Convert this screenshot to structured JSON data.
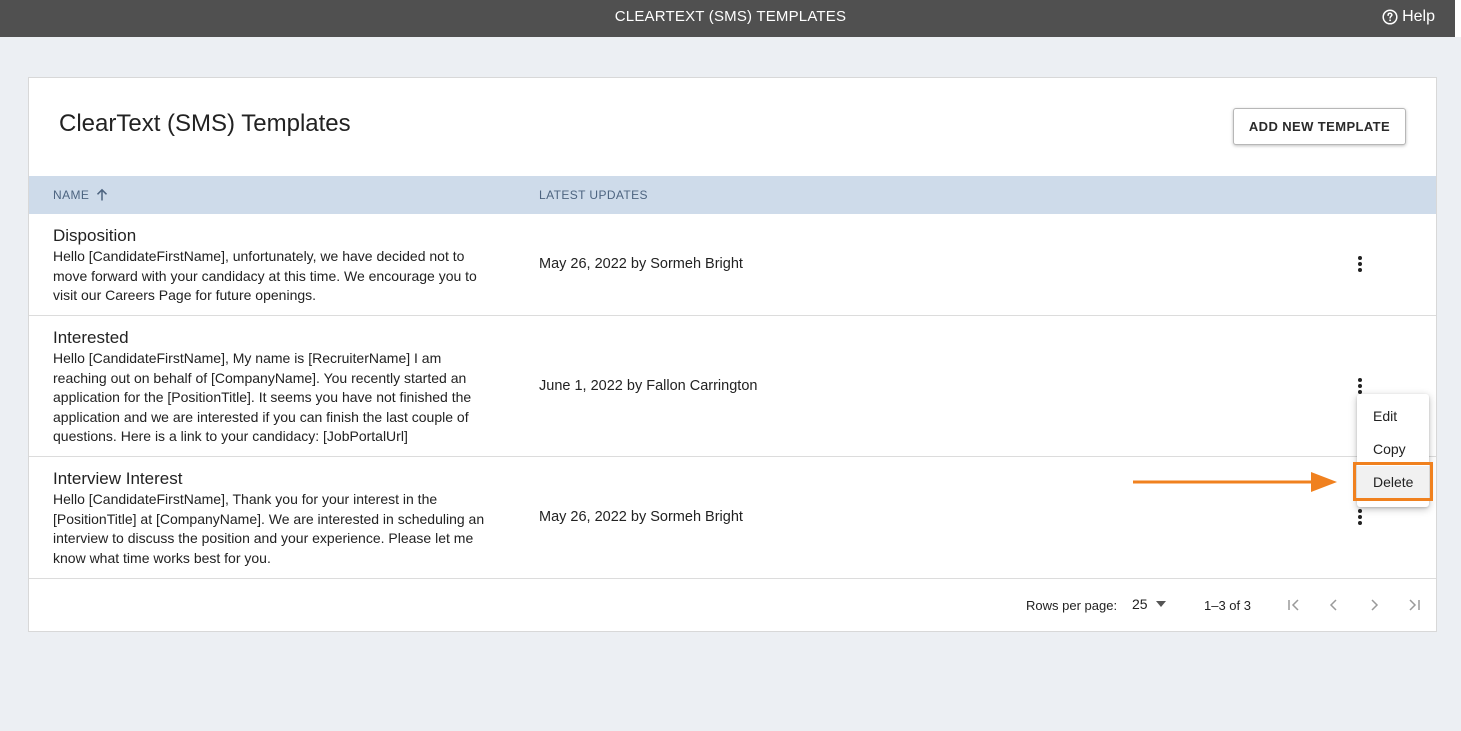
{
  "app": {
    "header_title": "CLEARTEXT (SMS) TEMPLATES",
    "help_label": "Help"
  },
  "card": {
    "title": "ClearText (SMS) Templates",
    "add_button": "ADD NEW TEMPLATE"
  },
  "table": {
    "columns": [
      {
        "label": "NAME",
        "sort": "ascending"
      },
      {
        "label": "LATEST UPDATES"
      }
    ],
    "rows": [
      {
        "name": "Disposition",
        "body_lines": [
          "Hello [CandidateFirstName], unfortunately, we have decided not to",
          "move forward with your candidacy at this time. We encourage you to",
          "visit our Careers Page for future openings."
        ],
        "updated": "May 26, 2022 by Sormeh Bright"
      },
      {
        "name": "Interested",
        "body_lines": [
          "Hello [CandidateFirstName], My name is [RecruiterName] I am",
          "reaching out on behalf of [CompanyName]. You recently started an",
          "application for the [PositionTitle]. It seems you have not finished the",
          "application and we are interested if you can finish the last couple of",
          "questions. Here is a link to your candidacy: [JobPortalUrl]"
        ],
        "updated": "June 1, 2022 by Fallon Carrington"
      },
      {
        "name": "Interview Interest",
        "body_lines": [
          "Hello [CandidateFirstName], Thank you for your interest in the",
          "[PositionTitle] at [CompanyName]. We are interested in scheduling an",
          "interview to discuss the position and your experience. Please let me",
          "know what time works best for you."
        ],
        "updated": "May 26, 2022 by Sormeh Bright"
      }
    ]
  },
  "context_menu": {
    "items": [
      "Edit",
      "Copy",
      "Delete"
    ],
    "highlighted": "Delete"
  },
  "pagination": {
    "rows_per_page_label": "Rows per page:",
    "rows_per_page_value": "25",
    "range_text": "1–3 of 3"
  },
  "colors": {
    "topbar": "#505050",
    "header_row": "#cedbea",
    "highlight": "#f0811f"
  }
}
